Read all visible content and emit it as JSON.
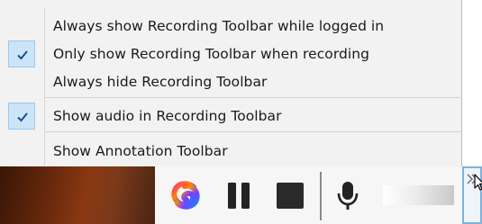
{
  "menu": {
    "items": [
      {
        "label": "Always show Recording Toolbar while logged in",
        "checked": false
      },
      {
        "label": "Only show Recording Toolbar when recording",
        "checked": true
      },
      {
        "label": "Always hide Recording Toolbar",
        "checked": false
      },
      {
        "label": "Show audio in Recording Toolbar",
        "checked": true
      },
      {
        "label": "Show Annotation Toolbar",
        "checked": false
      }
    ]
  },
  "toolbar": {
    "buttons": [
      {
        "icon": "app-logo-icon"
      },
      {
        "icon": "pause-icon"
      },
      {
        "icon": "stop-icon"
      },
      {
        "icon": "microphone-icon"
      },
      {
        "icon": "chevron-double-right-icon"
      }
    ]
  },
  "colors": {
    "menu_background": "#f2f2f2",
    "check_highlight": "#cce4f7",
    "check_border": "#99c9ef",
    "check_mark": "#1b4f8a",
    "toolbar_background": "#f6f6f6",
    "icon_dark": "#222222",
    "expand_border": "#7fb0da"
  }
}
